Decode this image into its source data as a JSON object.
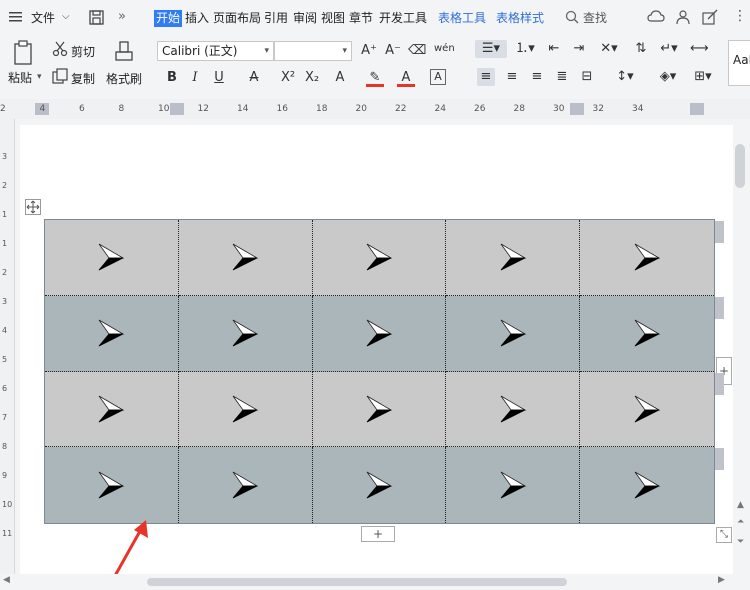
{
  "menubar": {
    "hamburger_label": "文件",
    "tabs": [
      "开始",
      "插入",
      "页面布局",
      "引用",
      "审阅",
      "视图",
      "章节",
      "开发工具"
    ],
    "tool_tabs": [
      "表格工具",
      "表格样式"
    ],
    "search_label": "查找"
  },
  "ribbon": {
    "paste_label": "粘贴",
    "cut_label": "剪切",
    "copy_label": "复制",
    "format_painter_label": "格式刷",
    "font_name": "Calibri (正文)",
    "font_size": "",
    "style_preview": "AaI"
  },
  "ruler": {
    "ticks": [
      "2",
      "4",
      "6",
      "8",
      "10",
      "12",
      "14",
      "16",
      "18",
      "20",
      "22",
      "24",
      "26",
      "28",
      "30",
      "32",
      "34"
    ]
  },
  "vruler": {
    "ticks": [
      "3",
      "2",
      "1",
      "1",
      "2",
      "3",
      "4",
      "5",
      "6",
      "7",
      "8",
      "9",
      "10",
      "11"
    ]
  },
  "table": {
    "rows": 4,
    "cols": 5
  },
  "add_row_label": "+",
  "colors": {
    "accent": "#2f7cf6",
    "row_light": "#c9c9c9",
    "row_dark": "#aab6ba",
    "annotation": "#e8332a"
  }
}
